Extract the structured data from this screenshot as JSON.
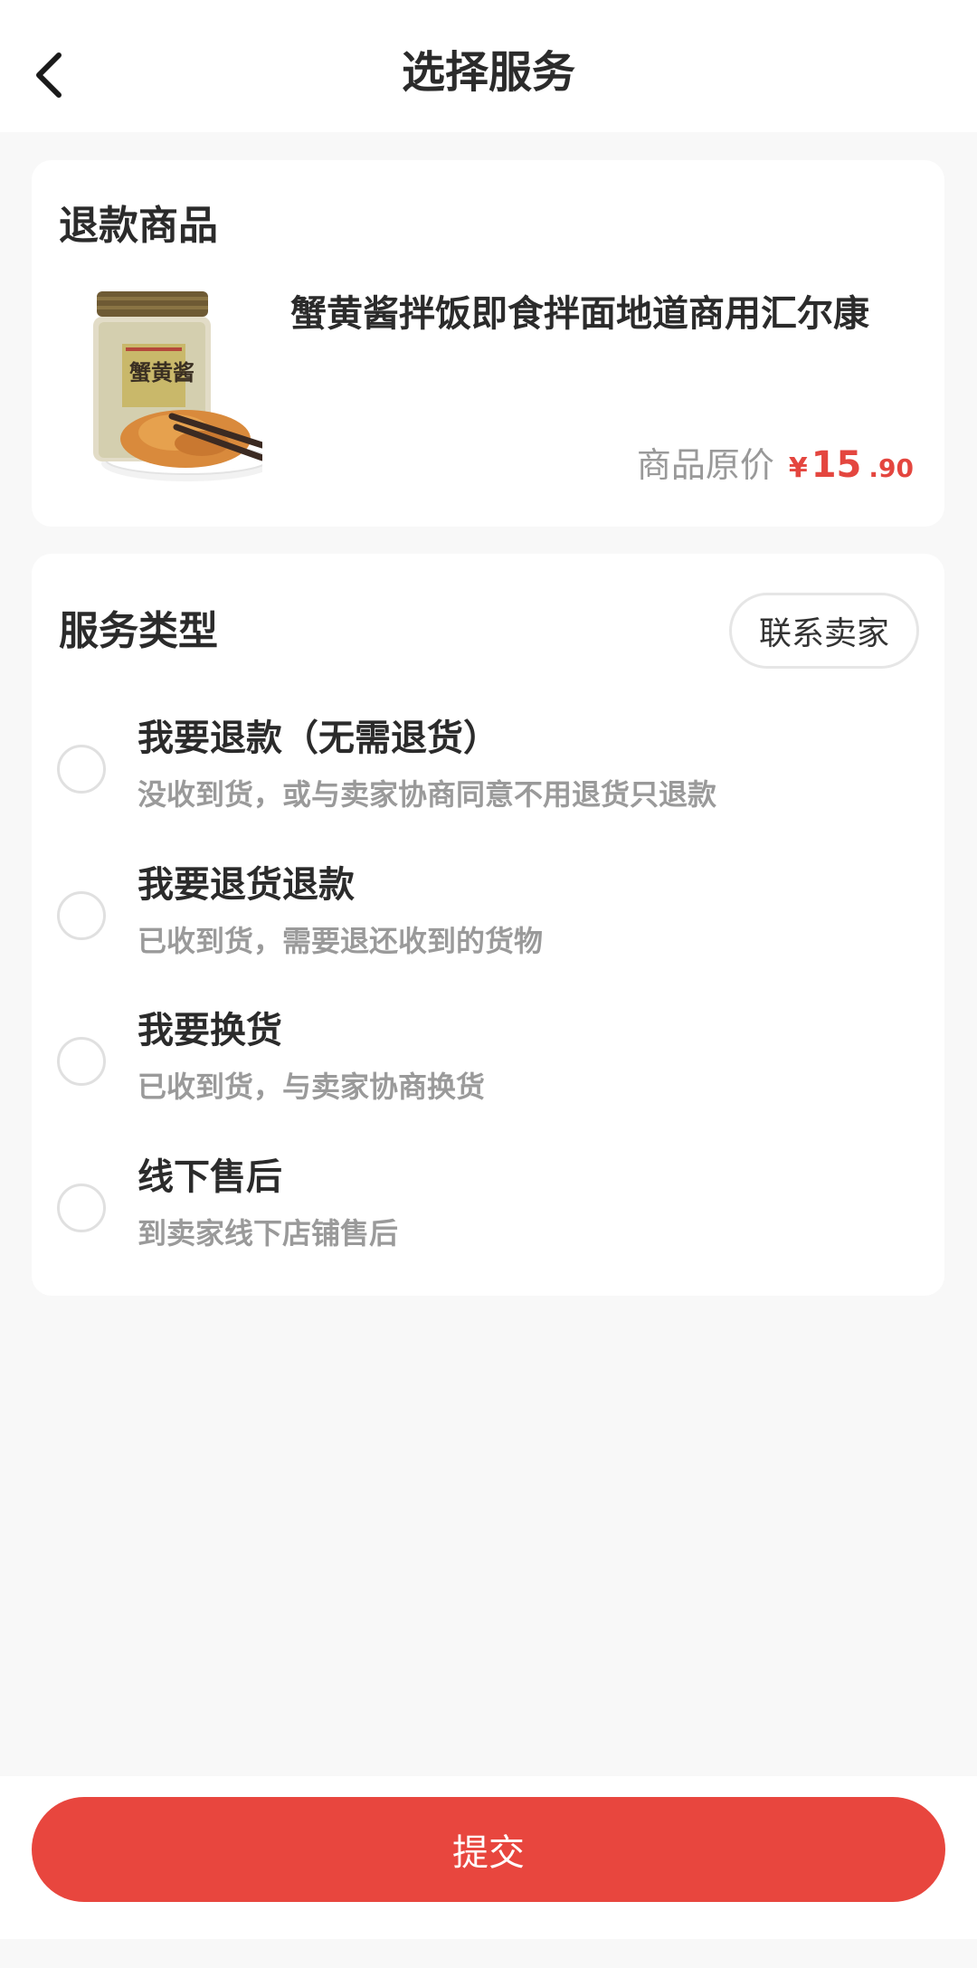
{
  "header": {
    "title": "选择服务",
    "back_icon": "chevron-left-icon"
  },
  "product_section": {
    "title": "退款商品",
    "product": {
      "name": "蟹黄酱拌饭即食拌面地道商用汇尔康",
      "image_label": "蟹黄酱",
      "price_label": "商品原价",
      "currency": "¥",
      "price_integer": "15",
      "price_decimal": ".90"
    }
  },
  "service_section": {
    "title": "服务类型",
    "contact_button": "联系卖家",
    "options": [
      {
        "title": "我要退款（无需退货）",
        "desc": "没收到货，或与卖家协商同意不用退货只退款",
        "selected": false
      },
      {
        "title": "我要退货退款",
        "desc": "已收到货，需要退还收到的货物",
        "selected": false
      },
      {
        "title": "我要换货",
        "desc": "已收到货，与卖家协商换货",
        "selected": false
      },
      {
        "title": "线下售后",
        "desc": "到卖家线下店铺售后",
        "selected": false
      }
    ]
  },
  "footer": {
    "submit_label": "提交"
  },
  "colors": {
    "accent": "#e8463e",
    "price": "#e4463f",
    "background": "#f8f8f8"
  }
}
